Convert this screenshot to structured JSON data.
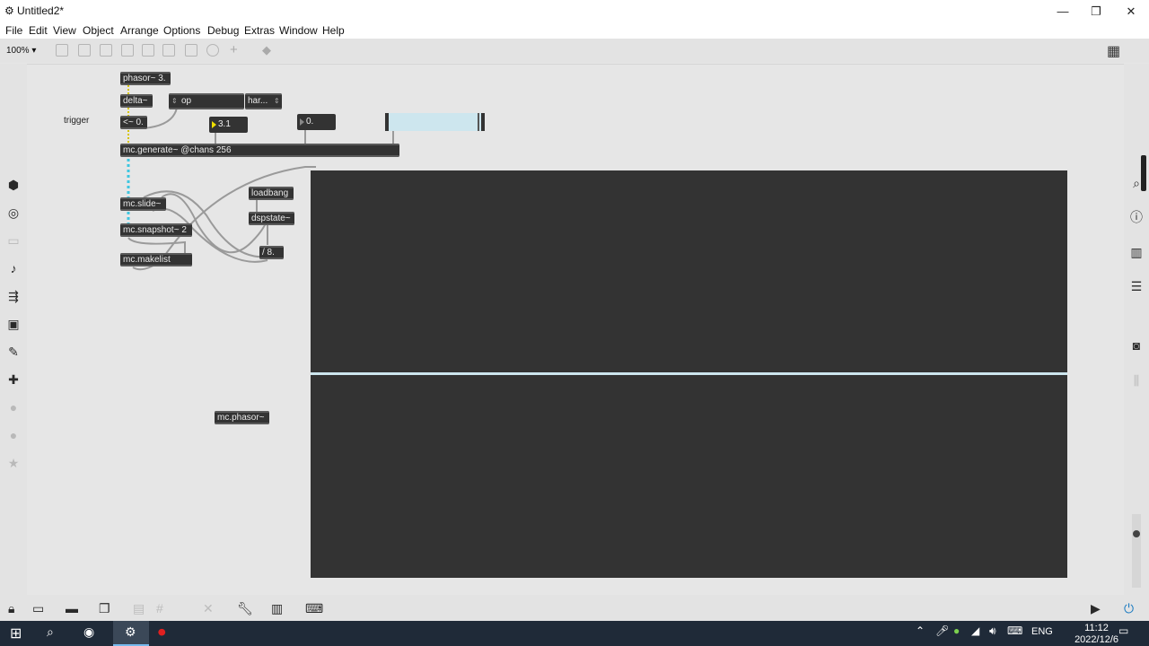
{
  "window": {
    "title": "Untitled2*",
    "minimize": "—",
    "maximize": "❐",
    "close": "✕"
  },
  "menu": [
    "File",
    "Edit",
    "View",
    "Object",
    "Arrange",
    "Options",
    "Debug",
    "Extras",
    "Window",
    "Help"
  ],
  "toolbar": {
    "zoom": "100% ▾"
  },
  "patch": {
    "comment_trigger": "trigger",
    "phasor": "phasor~ 3.",
    "delta": "delta~",
    "lt": "<~ 0.",
    "umenu_op": "op",
    "umenu_har": "har...",
    "num_31": "3.1",
    "num_0": "0.",
    "mc_generate": "mc.generate~ @chans 256",
    "mc_slide": "mc.slide~",
    "mc_snapshot": "mc.snapshot~ 2",
    "mc_makelist": "mc.makelist",
    "loadbang": "loadbang",
    "dspstate": "dspstate~",
    "div8": "/ 8.",
    "mc_phasor": "mc.phasor~"
  },
  "taskbar": {
    "lang": "ENG",
    "time": "11:12",
    "date": "2022/12/6"
  },
  "colors": {
    "object_bg": "#333333",
    "canvas_bg": "#e6e6e6",
    "mc_cable": "#3fc6e0",
    "slider_fill": "#cde6ee",
    "taskbar_bg": "#1f2a38"
  }
}
